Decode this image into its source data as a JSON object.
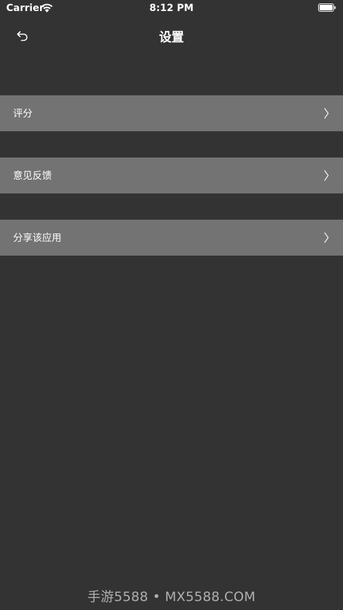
{
  "status_bar": {
    "carrier": "Carrier",
    "time": "8:12 PM",
    "wifi_icon": "wifi-icon",
    "battery_icon": "battery-icon"
  },
  "nav": {
    "title": "设置",
    "back_icon": "back-arrow-icon"
  },
  "settings": {
    "items": [
      {
        "label": "评分"
      },
      {
        "label": "意见反馈"
      },
      {
        "label": "分享该应用"
      }
    ]
  },
  "watermark": {
    "text": "手游5588 • MX5588.COM"
  },
  "colors": {
    "background": "#333333",
    "row_background": "#737373",
    "text": "#ffffff",
    "watermark": "#b0b0b0"
  }
}
